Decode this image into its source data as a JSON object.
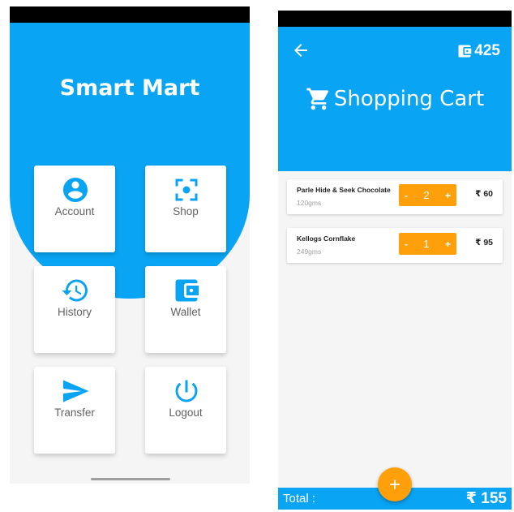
{
  "home": {
    "app_title": "Smart Mart",
    "tiles": [
      {
        "label": "Account",
        "icon": "account-circle-icon"
      },
      {
        "label": "Shop",
        "icon": "scan-icon"
      },
      {
        "label": "History",
        "icon": "history-icon"
      },
      {
        "label": "Wallet",
        "icon": "wallet-icon"
      },
      {
        "label": "Transfer",
        "icon": "send-icon"
      },
      {
        "label": "Logout",
        "icon": "power-icon"
      }
    ]
  },
  "cart": {
    "wallet_balance": "425",
    "title": "Shopping Cart",
    "currency": "₹",
    "items": [
      {
        "name": "Parle Hide & Seek Chocolate",
        "weight": "120gms",
        "quantity": "2",
        "price": "₹ 60"
      },
      {
        "name": "Kellogs Cornflake",
        "weight": "249gms",
        "quantity": "1",
        "price": "₹ 95"
      }
    ],
    "stepper": {
      "minus": "-",
      "plus": "+"
    },
    "total_label": "Total :",
    "total_value": "₹ 155"
  },
  "colors": {
    "primary": "#0aa4f4",
    "accent": "#ff9f0a",
    "background": "#f5f5f5"
  }
}
